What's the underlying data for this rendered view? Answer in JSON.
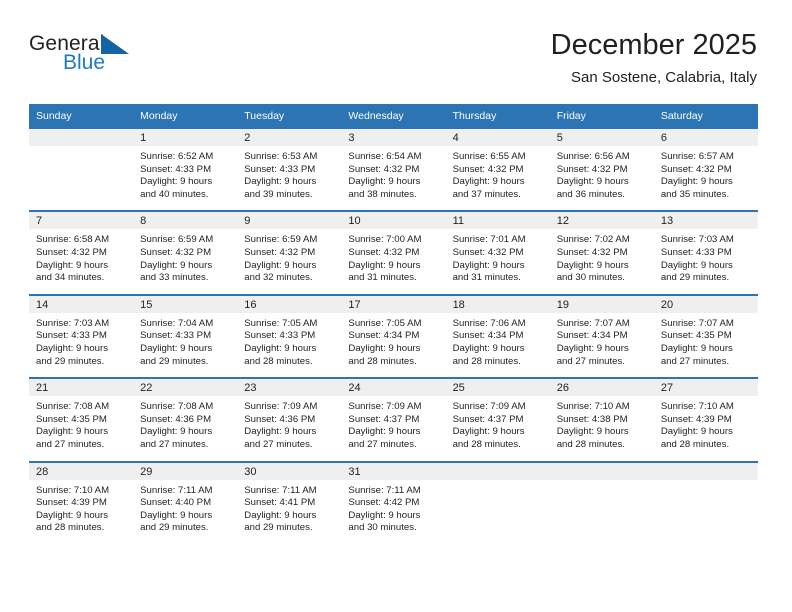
{
  "brand": {
    "name_part1": "General",
    "name_part2": "Blue",
    "accent_color": "#1f7ac0",
    "triangle_color": "#1464a5"
  },
  "header": {
    "title": "December 2025",
    "location": "San Sostene, Calabria, Italy"
  },
  "calendar": {
    "header_bg": "#2d74b5",
    "daynum_bg": "#efefef",
    "weekdays": [
      "Sunday",
      "Monday",
      "Tuesday",
      "Wednesday",
      "Thursday",
      "Friday",
      "Saturday"
    ],
    "weeks": [
      [
        {
          "day": "",
          "empty": true
        },
        {
          "day": "1",
          "sunrise": "Sunrise: 6:52 AM",
          "sunset": "Sunset: 4:33 PM",
          "daylight_line1": "Daylight: 9 hours",
          "daylight_line2": "and 40 minutes."
        },
        {
          "day": "2",
          "sunrise": "Sunrise: 6:53 AM",
          "sunset": "Sunset: 4:33 PM",
          "daylight_line1": "Daylight: 9 hours",
          "daylight_line2": "and 39 minutes."
        },
        {
          "day": "3",
          "sunrise": "Sunrise: 6:54 AM",
          "sunset": "Sunset: 4:32 PM",
          "daylight_line1": "Daylight: 9 hours",
          "daylight_line2": "and 38 minutes."
        },
        {
          "day": "4",
          "sunrise": "Sunrise: 6:55 AM",
          "sunset": "Sunset: 4:32 PM",
          "daylight_line1": "Daylight: 9 hours",
          "daylight_line2": "and 37 minutes."
        },
        {
          "day": "5",
          "sunrise": "Sunrise: 6:56 AM",
          "sunset": "Sunset: 4:32 PM",
          "daylight_line1": "Daylight: 9 hours",
          "daylight_line2": "and 36 minutes."
        },
        {
          "day": "6",
          "sunrise": "Sunrise: 6:57 AM",
          "sunset": "Sunset: 4:32 PM",
          "daylight_line1": "Daylight: 9 hours",
          "daylight_line2": "and 35 minutes."
        }
      ],
      [
        {
          "day": "7",
          "sunrise": "Sunrise: 6:58 AM",
          "sunset": "Sunset: 4:32 PM",
          "daylight_line1": "Daylight: 9 hours",
          "daylight_line2": "and 34 minutes."
        },
        {
          "day": "8",
          "sunrise": "Sunrise: 6:59 AM",
          "sunset": "Sunset: 4:32 PM",
          "daylight_line1": "Daylight: 9 hours",
          "daylight_line2": "and 33 minutes."
        },
        {
          "day": "9",
          "sunrise": "Sunrise: 6:59 AM",
          "sunset": "Sunset: 4:32 PM",
          "daylight_line1": "Daylight: 9 hours",
          "daylight_line2": "and 32 minutes."
        },
        {
          "day": "10",
          "sunrise": "Sunrise: 7:00 AM",
          "sunset": "Sunset: 4:32 PM",
          "daylight_line1": "Daylight: 9 hours",
          "daylight_line2": "and 31 minutes."
        },
        {
          "day": "11",
          "sunrise": "Sunrise: 7:01 AM",
          "sunset": "Sunset: 4:32 PM",
          "daylight_line1": "Daylight: 9 hours",
          "daylight_line2": "and 31 minutes."
        },
        {
          "day": "12",
          "sunrise": "Sunrise: 7:02 AM",
          "sunset": "Sunset: 4:32 PM",
          "daylight_line1": "Daylight: 9 hours",
          "daylight_line2": "and 30 minutes."
        },
        {
          "day": "13",
          "sunrise": "Sunrise: 7:03 AM",
          "sunset": "Sunset: 4:33 PM",
          "daylight_line1": "Daylight: 9 hours",
          "daylight_line2": "and 29 minutes."
        }
      ],
      [
        {
          "day": "14",
          "sunrise": "Sunrise: 7:03 AM",
          "sunset": "Sunset: 4:33 PM",
          "daylight_line1": "Daylight: 9 hours",
          "daylight_line2": "and 29 minutes."
        },
        {
          "day": "15",
          "sunrise": "Sunrise: 7:04 AM",
          "sunset": "Sunset: 4:33 PM",
          "daylight_line1": "Daylight: 9 hours",
          "daylight_line2": "and 29 minutes."
        },
        {
          "day": "16",
          "sunrise": "Sunrise: 7:05 AM",
          "sunset": "Sunset: 4:33 PM",
          "daylight_line1": "Daylight: 9 hours",
          "daylight_line2": "and 28 minutes."
        },
        {
          "day": "17",
          "sunrise": "Sunrise: 7:05 AM",
          "sunset": "Sunset: 4:34 PM",
          "daylight_line1": "Daylight: 9 hours",
          "daylight_line2": "and 28 minutes."
        },
        {
          "day": "18",
          "sunrise": "Sunrise: 7:06 AM",
          "sunset": "Sunset: 4:34 PM",
          "daylight_line1": "Daylight: 9 hours",
          "daylight_line2": "and 28 minutes."
        },
        {
          "day": "19",
          "sunrise": "Sunrise: 7:07 AM",
          "sunset": "Sunset: 4:34 PM",
          "daylight_line1": "Daylight: 9 hours",
          "daylight_line2": "and 27 minutes."
        },
        {
          "day": "20",
          "sunrise": "Sunrise: 7:07 AM",
          "sunset": "Sunset: 4:35 PM",
          "daylight_line1": "Daylight: 9 hours",
          "daylight_line2": "and 27 minutes."
        }
      ],
      [
        {
          "day": "21",
          "sunrise": "Sunrise: 7:08 AM",
          "sunset": "Sunset: 4:35 PM",
          "daylight_line1": "Daylight: 9 hours",
          "daylight_line2": "and 27 minutes."
        },
        {
          "day": "22",
          "sunrise": "Sunrise: 7:08 AM",
          "sunset": "Sunset: 4:36 PM",
          "daylight_line1": "Daylight: 9 hours",
          "daylight_line2": "and 27 minutes."
        },
        {
          "day": "23",
          "sunrise": "Sunrise: 7:09 AM",
          "sunset": "Sunset: 4:36 PM",
          "daylight_line1": "Daylight: 9 hours",
          "daylight_line2": "and 27 minutes."
        },
        {
          "day": "24",
          "sunrise": "Sunrise: 7:09 AM",
          "sunset": "Sunset: 4:37 PM",
          "daylight_line1": "Daylight: 9 hours",
          "daylight_line2": "and 27 minutes."
        },
        {
          "day": "25",
          "sunrise": "Sunrise: 7:09 AM",
          "sunset": "Sunset: 4:37 PM",
          "daylight_line1": "Daylight: 9 hours",
          "daylight_line2": "and 28 minutes."
        },
        {
          "day": "26",
          "sunrise": "Sunrise: 7:10 AM",
          "sunset": "Sunset: 4:38 PM",
          "daylight_line1": "Daylight: 9 hours",
          "daylight_line2": "and 28 minutes."
        },
        {
          "day": "27",
          "sunrise": "Sunrise: 7:10 AM",
          "sunset": "Sunset: 4:39 PM",
          "daylight_line1": "Daylight: 9 hours",
          "daylight_line2": "and 28 minutes."
        }
      ],
      [
        {
          "day": "28",
          "sunrise": "Sunrise: 7:10 AM",
          "sunset": "Sunset: 4:39 PM",
          "daylight_line1": "Daylight: 9 hours",
          "daylight_line2": "and 28 minutes."
        },
        {
          "day": "29",
          "sunrise": "Sunrise: 7:11 AM",
          "sunset": "Sunset: 4:40 PM",
          "daylight_line1": "Daylight: 9 hours",
          "daylight_line2": "and 29 minutes."
        },
        {
          "day": "30",
          "sunrise": "Sunrise: 7:11 AM",
          "sunset": "Sunset: 4:41 PM",
          "daylight_line1": "Daylight: 9 hours",
          "daylight_line2": "and 29 minutes."
        },
        {
          "day": "31",
          "sunrise": "Sunrise: 7:11 AM",
          "sunset": "Sunset: 4:42 PM",
          "daylight_line1": "Daylight: 9 hours",
          "daylight_line2": "and 30 minutes."
        },
        {
          "day": "",
          "empty": true
        },
        {
          "day": "",
          "empty": true
        },
        {
          "day": "",
          "empty": true
        }
      ]
    ]
  }
}
